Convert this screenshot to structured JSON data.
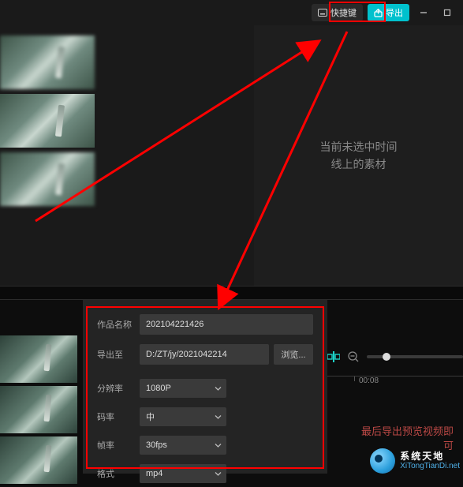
{
  "topbar": {
    "shortcut_label": "快捷键",
    "export_label": "导出"
  },
  "preview": {
    "empty_line1": "当前未选中时间",
    "empty_line2": "线上的素材"
  },
  "export_form": {
    "name_label": "作品名称",
    "name_value": "202104221426",
    "dest_label": "导出至",
    "dest_value": "D:/ZT/jy/2021042214",
    "browse_label": "浏览...",
    "resolution_label": "分辨率",
    "resolution_value": "1080P",
    "bitrate_label": "码率",
    "bitrate_value": "中",
    "fps_label": "帧率",
    "fps_value": "30fps",
    "format_label": "格式",
    "format_value": "mp4"
  },
  "timeline": {
    "tick_label": "00:08"
  },
  "hint": {
    "line1": "最后导出预览视频即",
    "line2": "可"
  },
  "watermark": {
    "name": "系统天地",
    "url": "XiTongTianDi.net"
  }
}
